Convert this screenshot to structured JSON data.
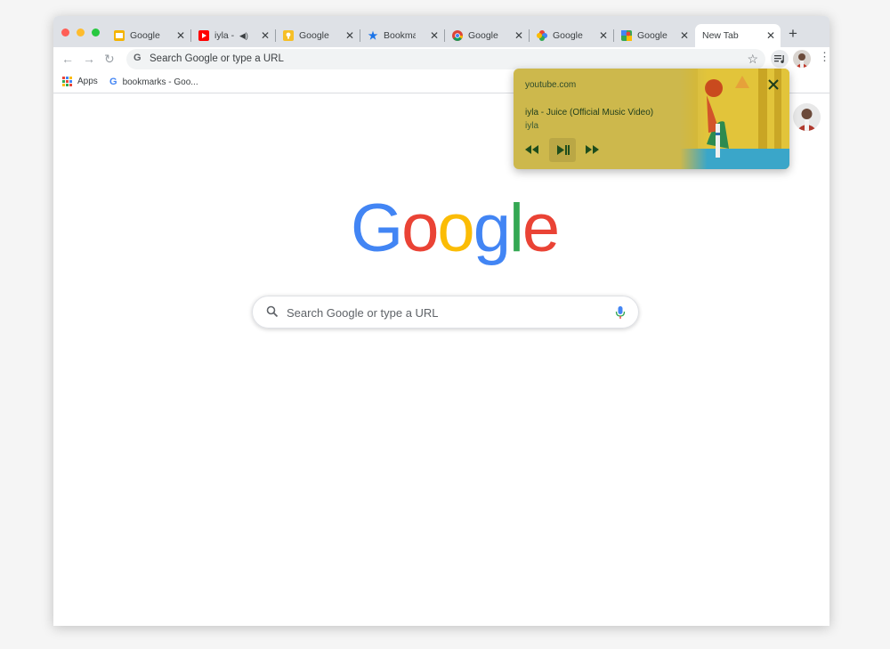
{
  "tabs": [
    {
      "title": "Google Slides",
      "favicon": "slides-icon",
      "color": "#f4b400"
    },
    {
      "title": "iyla - Juice",
      "favicon": "youtube-icon",
      "color": "#ff0000",
      "audio": true
    },
    {
      "title": "Google Keep",
      "favicon": "keep-icon",
      "color": "#f6bf26"
    },
    {
      "title": "Bookmarks",
      "favicon": "star-icon",
      "color": "#1a73e8"
    },
    {
      "title": "Google Chrome",
      "favicon": "chrome-icon",
      "color": "#4285f4"
    },
    {
      "title": "Google Photos",
      "favicon": "photos-icon",
      "color": "#fbbc04"
    },
    {
      "title": "Google Maps",
      "favicon": "maps-icon",
      "color": "#34a853"
    }
  ],
  "active_tab": {
    "title": "New Tab"
  },
  "omnibox": {
    "placeholder": "Search Google or type a URL"
  },
  "bookmarks": {
    "apps": "Apps",
    "item": "bookmarks - Goo..."
  },
  "ntp": {
    "logo": [
      "G",
      "o",
      "o",
      "g",
      "l",
      "e"
    ],
    "logo_colors": [
      "#4285f4",
      "#ea4335",
      "#fbbc05",
      "#4285f4",
      "#34a853",
      "#ea4335"
    ],
    "search_placeholder": "Search Google or type a URL"
  },
  "media": {
    "source": "youtube.com",
    "title": "iyla - Juice (Official Music Video)",
    "artist": "iyla"
  }
}
